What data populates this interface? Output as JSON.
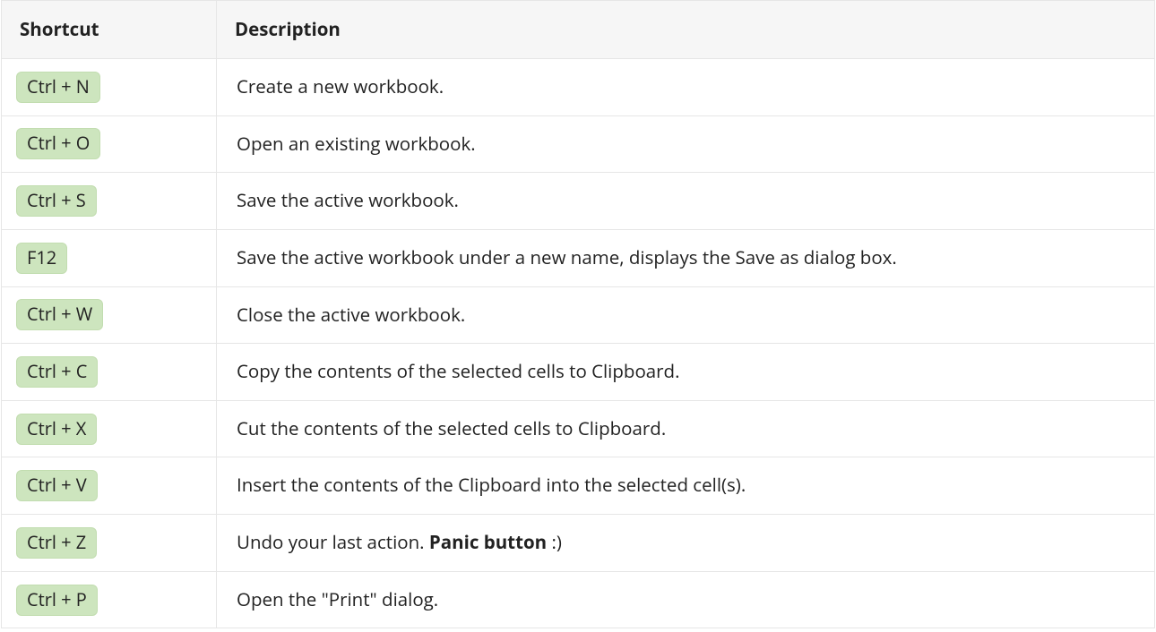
{
  "headers": {
    "shortcut": "Shortcut",
    "description": "Description"
  },
  "rows": [
    {
      "shortcut": "Ctrl + N",
      "desc_pre": "Create a new workbook.",
      "desc_bold": "",
      "desc_post": ""
    },
    {
      "shortcut": "Ctrl + O",
      "desc_pre": "Open an existing workbook.",
      "desc_bold": "",
      "desc_post": ""
    },
    {
      "shortcut": "Ctrl + S",
      "desc_pre": "Save the active workbook.",
      "desc_bold": "",
      "desc_post": ""
    },
    {
      "shortcut": "F12",
      "desc_pre": "Save the active workbook under a new name, displays the Save as dialog box.",
      "desc_bold": "",
      "desc_post": ""
    },
    {
      "shortcut": "Ctrl + W",
      "desc_pre": "Close the active workbook.",
      "desc_bold": "",
      "desc_post": ""
    },
    {
      "shortcut": "Ctrl + C",
      "desc_pre": "Copy the contents of the selected cells to Clipboard.",
      "desc_bold": "",
      "desc_post": ""
    },
    {
      "shortcut": "Ctrl + X",
      "desc_pre": "Cut the contents of the selected cells to Clipboard.",
      "desc_bold": "",
      "desc_post": ""
    },
    {
      "shortcut": "Ctrl + V",
      "desc_pre": "Insert the contents of the Clipboard into the selected cell(s).",
      "desc_bold": "",
      "desc_post": ""
    },
    {
      "shortcut": "Ctrl + Z",
      "desc_pre": "Undo your last action. ",
      "desc_bold": "Panic button",
      "desc_post": " :)"
    },
    {
      "shortcut": "Ctrl + P",
      "desc_pre": "Open the \"Print\" dialog.",
      "desc_bold": "",
      "desc_post": ""
    }
  ]
}
